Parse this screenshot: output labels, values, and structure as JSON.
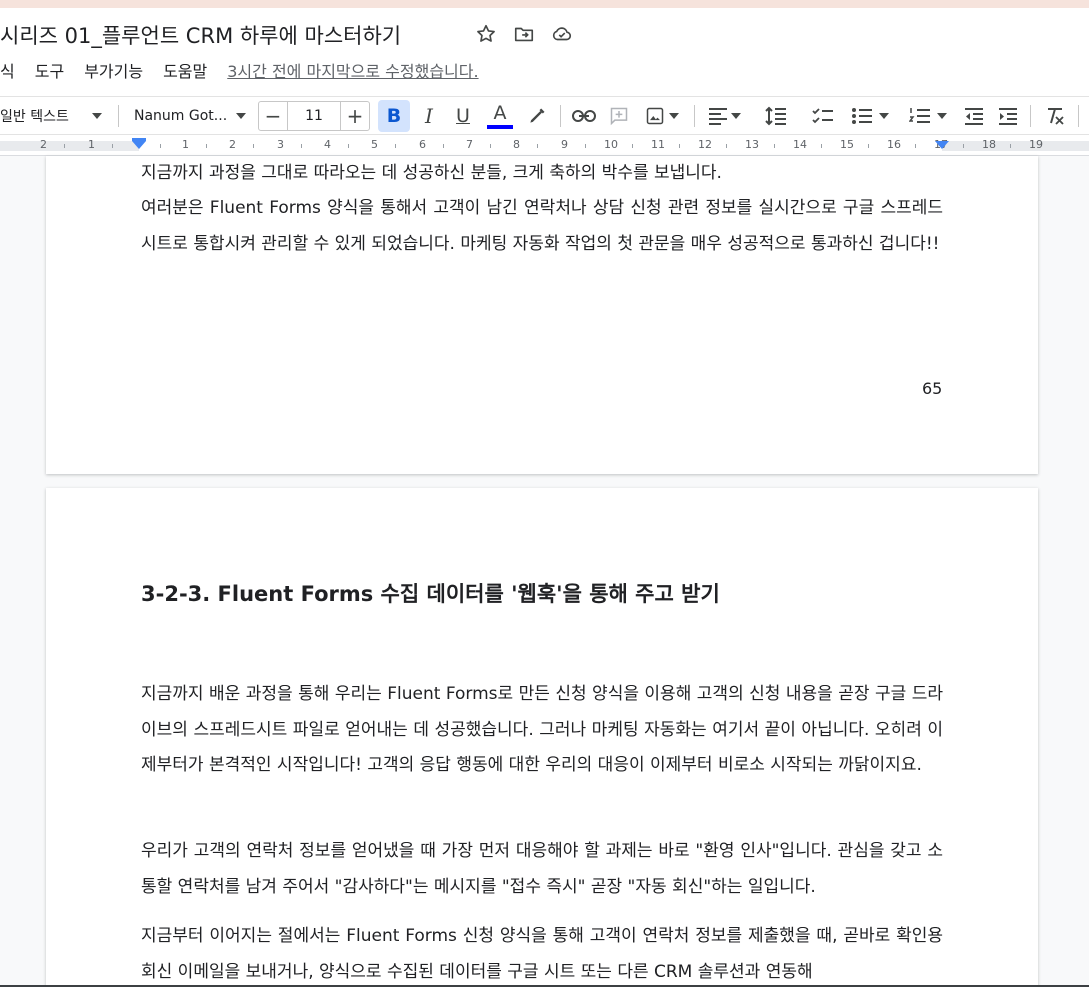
{
  "document": {
    "title": "시리즈 01_플루언트 CRM 하루에 마스터하기",
    "last_edit": "3시간 전에 마지막으로 수정했습니다."
  },
  "menu": [
    "식",
    "도구",
    "부가기능",
    "도움말"
  ],
  "toolbar": {
    "style": "일반 텍스트",
    "font": "Nanum Got...",
    "font_size": "11",
    "minus": "−",
    "plus": "+",
    "bold": "B",
    "italic": "I",
    "underline": "U",
    "text_color": "A",
    "text_color_hex": "#0000ff"
  },
  "ruler": {
    "labels": [
      "2",
      "1",
      "1",
      "2",
      "3",
      "4",
      "5",
      "6",
      "7",
      "8",
      "9",
      "10",
      "11",
      "12",
      "13",
      "14",
      "15",
      "16",
      "17",
      "18",
      "19"
    ]
  },
  "page1": {
    "paragraphs": [
      "지금까지 과정을 그대로 따라오는 데 성공하신 분들, 크게 축하의 박수를 보냅니다.",
      "여러분은 Fluent  Forms 양식을 통해서 고객이 남긴 연락처나 상담 신청 관련 정보를 실시간으로 구글 스프레드시트로 통합시켜 관리할 수 있게 되었습니다. 마케팅 자동화 작업의 첫 관문을 매우 성공적으로 통과하신 겁니다!!"
    ],
    "page_number": "65"
  },
  "page2": {
    "heading": "3-2-3.  Fluent Forms 수집 데이터를 '웹훅'을 통해 주고 받기",
    "paragraphs": [
      "지금까지 배운 과정을 통해 우리는 Fluent Forms로 만든 신청 양식을 이용해 고객의 신청 내용을 곧장 구글 드라이브의 스프레드시트 파일로 얻어내는 데 성공했습니다. 그러나 마케팅 자동화는 여기서 끝이 아닙니다. 오히려 이제부터가 본격적인 시작입니다! 고객의 응답 행동에 대한 우리의 대응이 이제부터 비로소 시작되는 까닭이지요.",
      "우리가 고객의 연락처 정보를 얻어냈을 때 가장 먼저 대응해야 할 과제는 바로 \"환영 인사\"입니다. 관심을 갖고 소통할 연락처를 남겨 주어서 \"감사하다\"는 메시지를 \"접수 즉시\" 곧장 \"자동 회신\"하는 일입니다.",
      "지금부터 이어지는 절에서는 Fluent Forms 신청 양식을 통해 고객이 연락처 정보를 제출했을 때, 곧바로 확인용 회신 이메일을 보내거나, 양식으로 수집된 데이터를 구글 시트 또는 다른 CRM 솔루션과 연동해"
    ]
  }
}
